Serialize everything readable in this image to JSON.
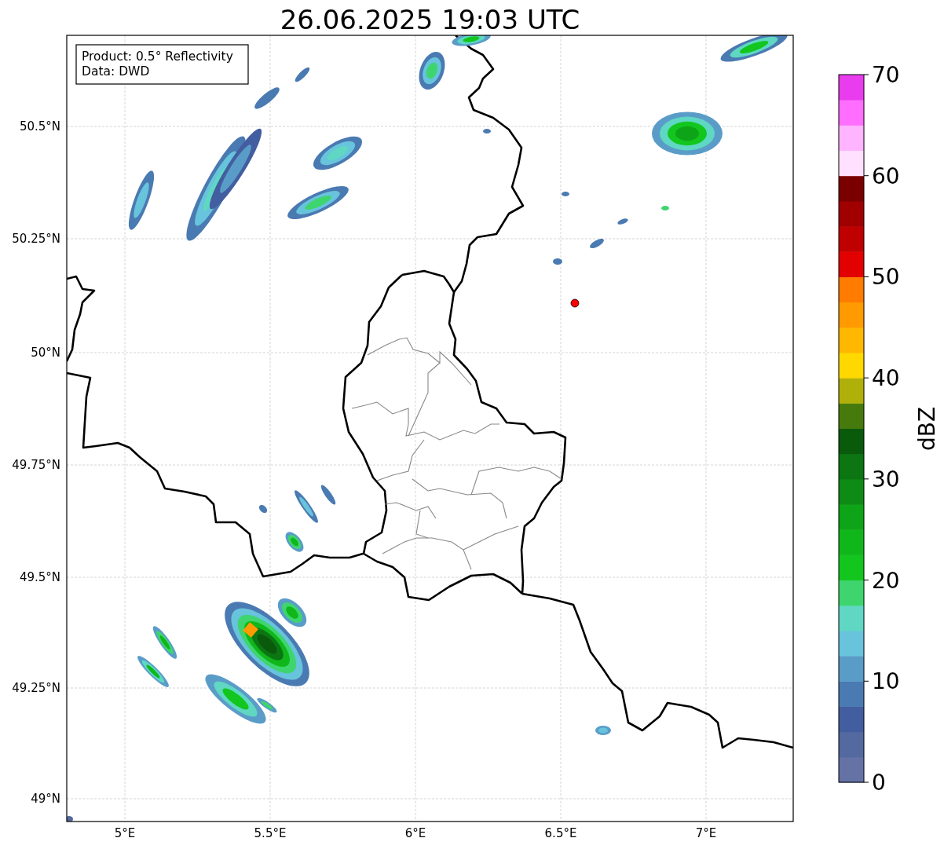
{
  "title": "26.06.2025 19:03 UTC",
  "info_box": [
    "Product: 0.5° Reflectivity",
    "Data: DWD"
  ],
  "x_axis": {
    "ticks": [
      "5°E",
      "5.5°E",
      "6°E",
      "6.5°E",
      "7°E"
    ]
  },
  "y_axis": {
    "ticks": [
      "50.5°N",
      "50.25°N",
      "50°N",
      "49.75°N",
      "49.5°N",
      "49.25°N",
      "49°N"
    ]
  },
  "colorbar": {
    "label": "dBZ",
    "ticks": [
      "70",
      "60",
      "50",
      "40",
      "30",
      "20",
      "10",
      "0"
    ],
    "steps": [
      {
        "color": "#6572a6"
      },
      {
        "color": "#53699f"
      },
      {
        "color": "#435ea0"
      },
      {
        "color": "#4a7ab2"
      },
      {
        "color": "#5a9cc8"
      },
      {
        "color": "#68c3dc"
      },
      {
        "color": "#5fd7c3"
      },
      {
        "color": "#3ed56e"
      },
      {
        "color": "#12c61e"
      },
      {
        "color": "#10b71b"
      },
      {
        "color": "#0ea417"
      },
      {
        "color": "#0d8b15"
      },
      {
        "color": "#0b7612"
      },
      {
        "color": "#0a5a0c"
      },
      {
        "color": "#477a0c"
      },
      {
        "color": "#b0b00a"
      },
      {
        "color": "#ffd800"
      },
      {
        "color": "#ffb700"
      },
      {
        "color": "#ff9b00"
      },
      {
        "color": "#ff7c00"
      },
      {
        "color": "#e20000"
      },
      {
        "color": "#c00000"
      },
      {
        "color": "#a00000"
      },
      {
        "color": "#7a0000"
      },
      {
        "color": "#ffe0ff"
      },
      {
        "color": "#ffb4ff"
      },
      {
        "color": "#ff6eff"
      },
      {
        "color": "#e83cee"
      }
    ]
  }
}
